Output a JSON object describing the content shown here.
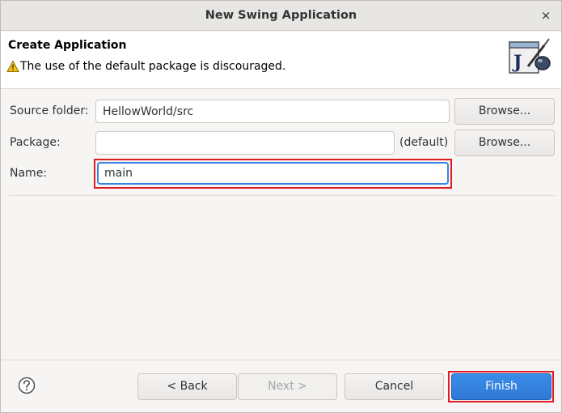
{
  "window": {
    "title": "New Swing Application",
    "close_glyph": "×"
  },
  "banner": {
    "title": "Create Application",
    "message": "The use of the default package is discouraged.",
    "message_icon": "warning-icon",
    "wizard_icon": "java-wizard-icon"
  },
  "form": {
    "source_folder": {
      "label": "Source folder:",
      "value": "HellowWorld/src",
      "browse_label": "Browse..."
    },
    "package": {
      "label": "Package:",
      "value": "",
      "default_text": "(default)",
      "browse_label": "Browse..."
    },
    "name": {
      "label": "Name:",
      "value": "main"
    }
  },
  "footer": {
    "help_icon": "help-icon",
    "back_label": "< Back",
    "next_label": "Next >",
    "cancel_label": "Cancel",
    "finish_label": "Finish"
  },
  "colors": {
    "accent": "#3584e4",
    "highlight": "#e01b24"
  }
}
